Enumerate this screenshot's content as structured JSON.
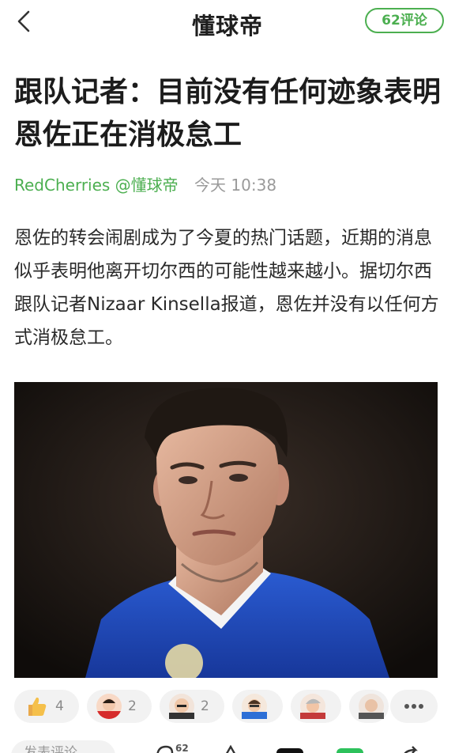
{
  "header": {
    "app_title": "懂球帝",
    "comment_button": "62评论"
  },
  "article": {
    "title": "跟队记者：目前没有任何迹象表明恩佐正在消极怠工",
    "author": "RedCherries @懂球帝",
    "time": "今天 10:38",
    "body": "恩佐的转会闹剧成为了今夏的热门话题，近期的消息似乎表明他离开切尔西的可能性越来越小。据切尔西跟队记者Nizaar Kinsella报道，恩佐并没有以任何方式消极怠工。"
  },
  "reactions": [
    {
      "icon": "thumbs-up-icon",
      "count": "4"
    },
    {
      "icon": "red-shirt-avatar-icon",
      "count": "2"
    },
    {
      "icon": "bald-avatar-icon",
      "count": "2"
    },
    {
      "icon": "blue-shirt-avatar-icon",
      "count": ""
    },
    {
      "icon": "grey-hair-avatar-icon",
      "count": ""
    },
    {
      "icon": "partial-avatar-icon",
      "count": ""
    }
  ],
  "bottombar": {
    "comment_placeholder": "发表评论",
    "comment_count": "62"
  },
  "colors": {
    "accent": "#4caf50",
    "kit_blue": "#1f4fbf"
  }
}
